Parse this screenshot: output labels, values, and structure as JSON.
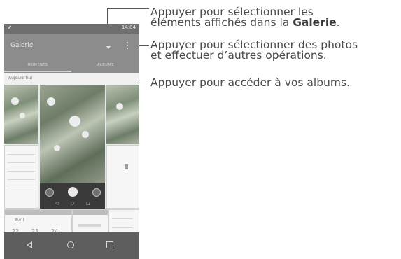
{
  "callouts": {
    "line1a": "Appuyer pour sélectionner les",
    "line1b_prefix": "éléments affichés dans la ",
    "line1b_bold": "Galerie",
    "line1b_suffix": ".",
    "line2a": "Appuyer pour sélectionner des photos",
    "line2b": "et effectuer d’autres opérations.",
    "line3": "Appuyer pour accéder à vos albums."
  },
  "phone": {
    "status_time": "14:04",
    "app_title": "Galerie",
    "tabs": [
      "MOMENTS",
      "ALBUMS"
    ],
    "section_label": "Aujourd'hui",
    "bottom_cells": [
      "Avril",
      "22",
      "23",
      "24"
    ]
  }
}
